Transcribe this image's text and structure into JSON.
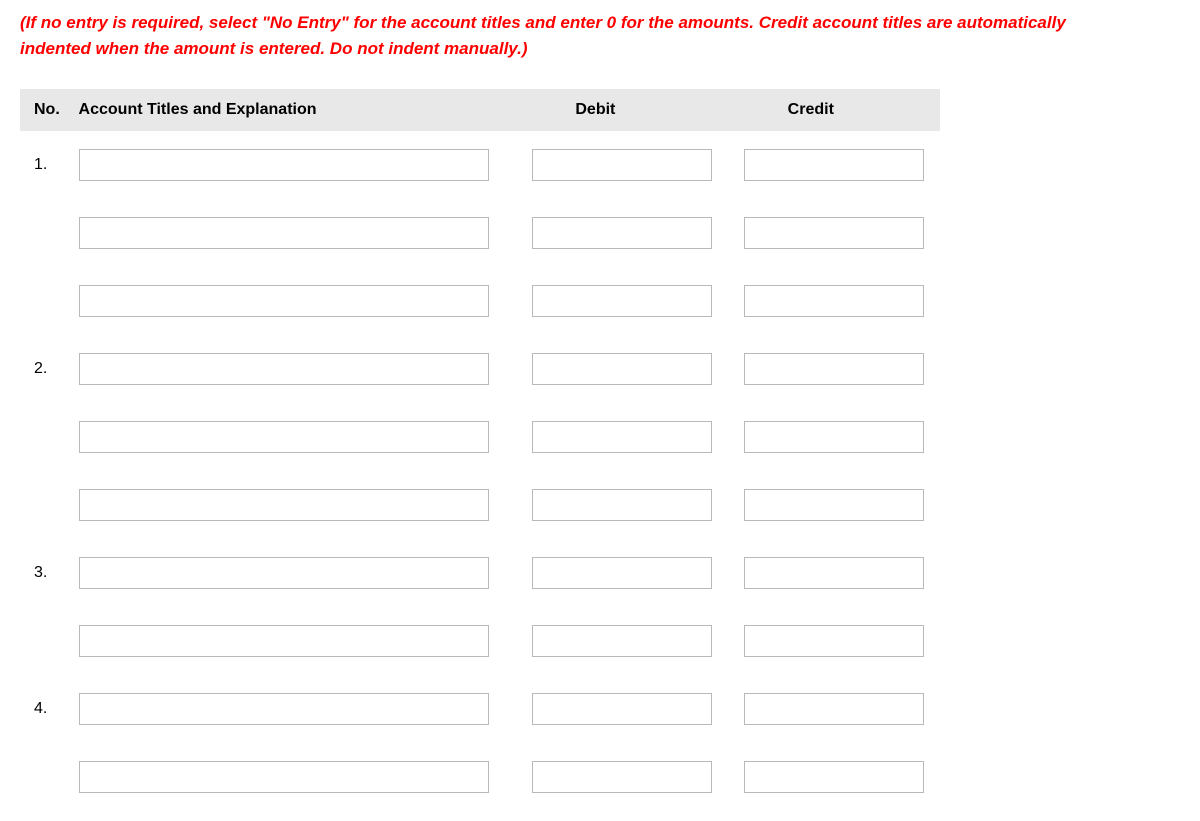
{
  "instruction": "(If no entry is required, select \"No Entry\" for the account titles and enter 0 for the amounts. Credit account titles are automatically indented when the amount is entered. Do not indent manually.)",
  "headers": {
    "no": "No.",
    "account": "Account Titles and Explanation",
    "debit": "Debit",
    "credit": "Credit"
  },
  "rows": [
    {
      "no": "1.",
      "account": "",
      "debit": "",
      "credit": ""
    },
    {
      "no": "",
      "account": "",
      "debit": "",
      "credit": ""
    },
    {
      "no": "",
      "account": "",
      "debit": "",
      "credit": ""
    },
    {
      "no": "2.",
      "account": "",
      "debit": "",
      "credit": ""
    },
    {
      "no": "",
      "account": "",
      "debit": "",
      "credit": ""
    },
    {
      "no": "",
      "account": "",
      "debit": "",
      "credit": ""
    },
    {
      "no": "3.",
      "account": "",
      "debit": "",
      "credit": ""
    },
    {
      "no": "",
      "account": "",
      "debit": "",
      "credit": ""
    },
    {
      "no": "4.",
      "account": "",
      "debit": "",
      "credit": ""
    },
    {
      "no": "",
      "account": "",
      "debit": "",
      "credit": ""
    }
  ]
}
